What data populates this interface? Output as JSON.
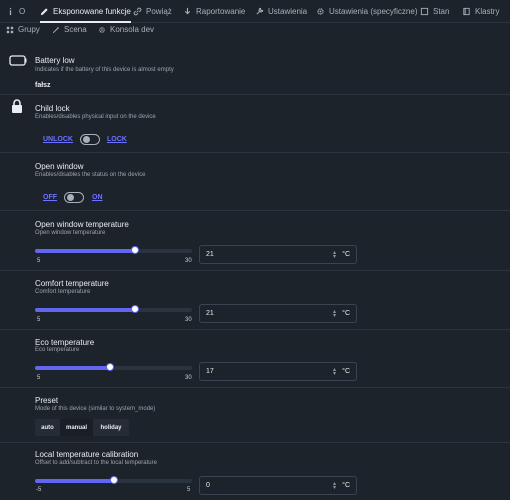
{
  "tabs": [
    {
      "label": "O",
      "icon": "info-icon"
    },
    {
      "label": "Eksponowane funkcje",
      "icon": "pencil-icon"
    },
    {
      "label": "Powiąż",
      "icon": "link-icon"
    },
    {
      "label": "Raportowanie",
      "icon": "download-icon"
    },
    {
      "label": "Ustawienia",
      "icon": "wrench-icon"
    },
    {
      "label": "Ustawienia (specyficzne)",
      "icon": "gear-icon"
    },
    {
      "label": "Stan",
      "icon": "square-icon"
    },
    {
      "label": "Klastry",
      "icon": "book-icon"
    }
  ],
  "subtabs": [
    {
      "label": "Grupy",
      "icon": "grid-icon"
    },
    {
      "label": "Scena",
      "icon": "wand-icon"
    },
    {
      "label": "Konsola dev",
      "icon": "gear-icon"
    }
  ],
  "battery": {
    "title": "Battery low",
    "desc": "Indicates if the battery of this device is almost empty",
    "value": "fałsz"
  },
  "child_lock": {
    "title": "Child lock",
    "desc": "Enables/disables physical input on the device",
    "off_label": "UNLOCK",
    "on_label": "LOCK"
  },
  "open_window": {
    "title": "Open window",
    "desc": "Enables/disables the status on the device",
    "off_label": "OFF",
    "on_label": "ON"
  },
  "open_window_temp": {
    "title": "Open window temperature",
    "desc": "Open window temperature",
    "min": "5",
    "max": "30",
    "value": "21",
    "unit": "°C",
    "level": 0.64
  },
  "comfort_temp": {
    "title": "Comfort temperature",
    "desc": "Comfort temperature",
    "min": "5",
    "max": "30",
    "value": "21",
    "unit": "°C",
    "level": 0.64
  },
  "eco_temp": {
    "title": "Eco temperature",
    "desc": "Eco temperature",
    "min": "5",
    "max": "30",
    "value": "17",
    "unit": "°C",
    "level": 0.48
  },
  "preset": {
    "title": "Preset",
    "desc": "Mode of this device (similar to system_mode)",
    "options": [
      "auto",
      "manual",
      "holiday"
    ],
    "selected": "manual"
  },
  "calibration": {
    "title": "Local temperature calibration",
    "desc": "Offset to add/subtract to the local temperature",
    "min": "-5",
    "max": "5",
    "value": "0",
    "unit": "°C",
    "level": 0.5
  },
  "colors": {
    "accent": "#6366f1",
    "link": "#6c72ff",
    "background": "#1d232a"
  }
}
